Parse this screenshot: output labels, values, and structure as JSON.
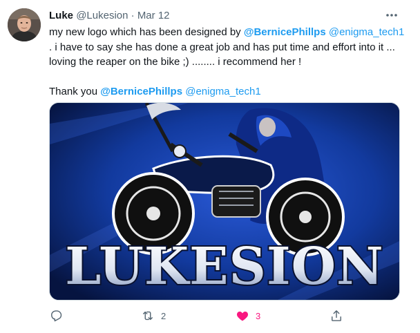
{
  "tweet": {
    "author_name": "Luke",
    "author_handle": "@Lukesion",
    "separator": "·",
    "date": "Mar 12",
    "text": {
      "l1_prefix": "my new logo which has been designed by ",
      "l1_mention_bold": "@BernicePhillps",
      "l1_mention": "@enigma_tech1",
      "l2": ". i have to say she has done a great job and has put time and effort into it ...",
      "l3": "loving the reaper on the bike ;) ........ i recommend her !",
      "l5_prefix": "Thank you ",
      "l5_mention_bold": "@BernicePhillps",
      "l5_mention": "@enigma_tech1"
    },
    "media": {
      "logo_text": "LUKESION"
    },
    "actions": {
      "reply_count": "",
      "retweet_count": "2",
      "like_count": "3"
    }
  },
  "colors": {
    "accent": "#1d9bf0",
    "like": "#f91880",
    "muted": "#536471"
  },
  "icons": [
    "more-icon",
    "reply-icon",
    "retweet-icon",
    "like-icon",
    "share-icon"
  ]
}
